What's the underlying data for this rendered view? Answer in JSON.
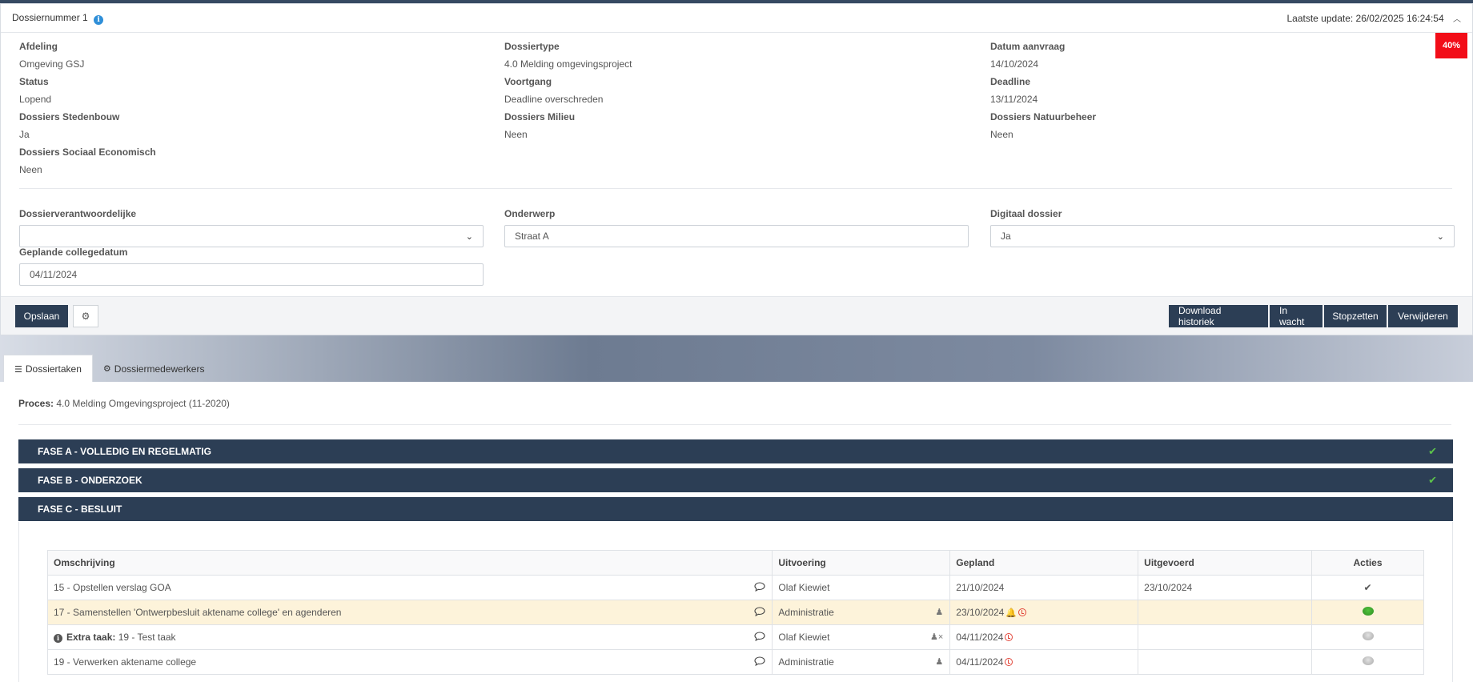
{
  "dossier": {
    "title": "Dossiernummer 1",
    "last_update": "Laatste update: 26/02/2025 16:24:54",
    "progress_badge": "40%",
    "progress_value": 40
  },
  "fields": {
    "afdeling": {
      "label": "Afdeling",
      "value": "Omgeving GSJ"
    },
    "dossiertype": {
      "label": "Dossiertype",
      "value": "4.0 Melding omgevingsproject"
    },
    "datum_aanvraag": {
      "label": "Datum aanvraag",
      "value": "14/10/2024"
    },
    "status": {
      "label": "Status",
      "value": "Lopend"
    },
    "voortgang": {
      "label": "Voortgang",
      "value": "Deadline overschreden"
    },
    "deadline": {
      "label": "Deadline",
      "value": "13/11/2024"
    },
    "stedenbouw": {
      "label": "Dossiers Stedenbouw",
      "value": "Ja"
    },
    "milieu": {
      "label": "Dossiers Milieu",
      "value": "Neen"
    },
    "natuurbeheer": {
      "label": "Dossiers Natuurbeheer",
      "value": "Neen"
    },
    "sociaal": {
      "label": "Dossiers Sociaal Economisch",
      "value": "Neen"
    }
  },
  "form": {
    "verantwoordelijke": {
      "label": "Dossierverantwoordelijke",
      "value": ""
    },
    "onderwerp": {
      "label": "Onderwerp",
      "value": "Straat A"
    },
    "digitaal": {
      "label": "Digitaal dossier",
      "value": "Ja"
    },
    "collegedatum": {
      "label": "Geplande collegedatum",
      "value": "04/11/2024"
    }
  },
  "footer": {
    "save": "Opslaan",
    "download": "Download historiek",
    "wait": "In wacht",
    "stop": "Stopzetten",
    "delete": "Verwijderen"
  },
  "tabs": [
    {
      "label": "Dossiertaken",
      "active": true
    },
    {
      "label": "Dossiermedewerkers",
      "active": false
    }
  ],
  "proces": {
    "label": "Proces:",
    "value": "4.0 Melding Omgevingsproject (11-2020)"
  },
  "phases": [
    {
      "label": "FASE A - VOLLEDIG EN REGELMATIG",
      "done": true
    },
    {
      "label": "FASE B - ONDERZOEK",
      "done": true
    },
    {
      "label": "FASE C - BESLUIT",
      "done": false
    }
  ],
  "table": {
    "headers": [
      "Omschrijving",
      "Uitvoering",
      "Gepland",
      "Uitgevoerd",
      "Acties"
    ],
    "rows": [
      {
        "omschrijving": "15 - Opstellen verslag GOA",
        "uitvoering": "Olaf Kiewiet",
        "gepland": "21/10/2024",
        "uitgevoerd": "23/10/2024",
        "actie": "check"
      },
      {
        "omschrijving": "17 - Samenstellen 'Ontwerpbesluit aktename college' en agenderen",
        "uitvoering": "Administratie",
        "gepland": "23/10/2024",
        "uitgevoerd": "",
        "actie": "green"
      },
      {
        "prefix": "Extra taak:",
        "omschrijving": "19 - Test taak",
        "uitvoering": "Olaf Kiewiet",
        "gepland": "04/11/2024",
        "uitgevoerd": "",
        "actie": "grey"
      },
      {
        "omschrijving": "19 - Verwerken aktename college",
        "uitvoering": "Administratie",
        "gepland": "04/11/2024",
        "uitgevoerd": "",
        "actie": "grey"
      }
    ]
  },
  "colors": {
    "primary": "#2c3e55",
    "badge": "#f20d18",
    "check": "#5cc24b",
    "highlight": "#fdf3da"
  }
}
